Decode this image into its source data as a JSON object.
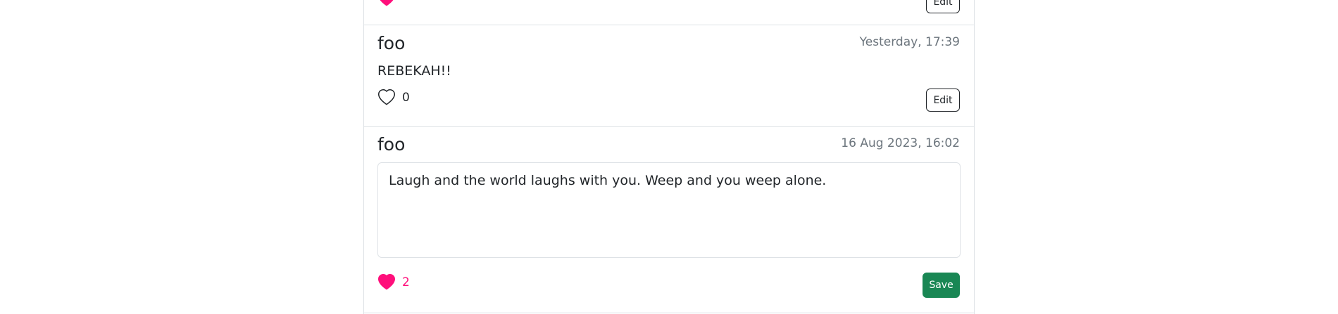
{
  "colors": {
    "like_active": "#ff0f7b",
    "save_button": "#198754",
    "timestamp": "#6c757d",
    "border": "#dee2e6"
  },
  "partial_post": {
    "edit_label": "Edit",
    "like_icon": "heart-filled-icon"
  },
  "posts": [
    {
      "username": "foo",
      "timestamp": "Yesterday, 17:39",
      "body": "REBEKAH!!",
      "like_icon": "heart-outline-icon",
      "liked": false,
      "like_count": "0",
      "action_label": "Edit"
    },
    {
      "username": "foo",
      "timestamp": "16 Aug 2023, 16:02",
      "body": "Laugh and the world laughs with you. Weep and you weep alone.",
      "like_icon": "heart-filled-icon",
      "liked": true,
      "like_count": "2",
      "action_label": "Save",
      "editing": true
    }
  ]
}
